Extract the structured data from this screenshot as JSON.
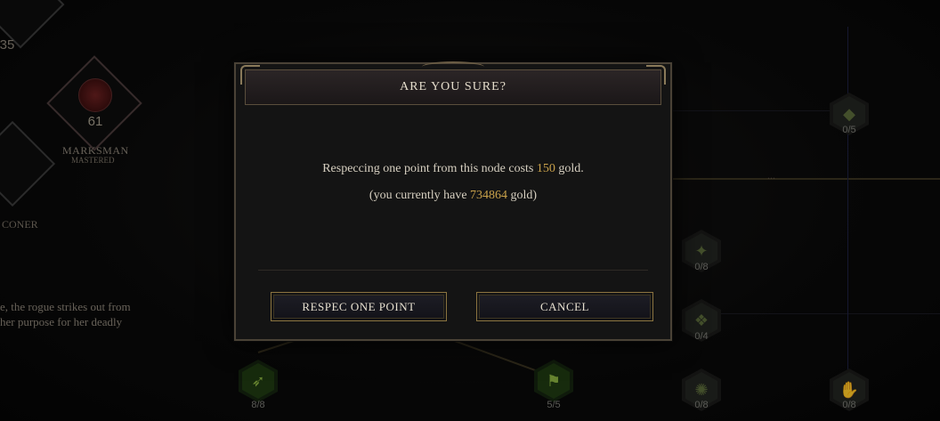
{
  "background": {
    "nodes": [
      {
        "id": "top-left",
        "count": "35"
      },
      {
        "id": "marksman",
        "count": "61",
        "name": "MARKSMAN",
        "status": "MASTERED"
      },
      {
        "id": "falconer",
        "name": "CONER"
      },
      {
        "id": "r1",
        "count": "0/5"
      },
      {
        "id": "r2",
        "count": "0/8"
      },
      {
        "id": "r3",
        "count": "0/4"
      },
      {
        "id": "b1",
        "count": "8/8"
      },
      {
        "id": "b2",
        "count": "5/5"
      },
      {
        "id": "b3",
        "count": "0/8"
      },
      {
        "id": "b4",
        "count": "0/8"
      }
    ],
    "description_line1": "e, the rogue strikes out from",
    "description_line2": "her purpose for her deadly",
    "ellipsis": "..."
  },
  "dialog": {
    "title": "ARE YOU SURE?",
    "line1_prefix": "Respeccing one point from this node costs ",
    "cost": "150",
    "line1_suffix": " gold.",
    "line2_prefix": "(you currently have ",
    "current_gold": "734864",
    "line2_suffix": " gold)",
    "respec_label": "RESPEC ONE POINT",
    "cancel_label": "CANCEL"
  },
  "colors": {
    "gold_text": "#c9a14a",
    "button_border": "#8b7440",
    "panel_bg": "#141414"
  }
}
